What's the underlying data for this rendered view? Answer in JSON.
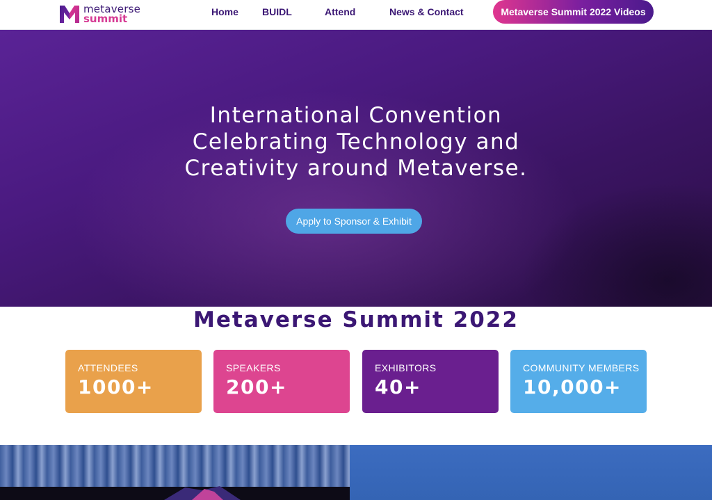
{
  "header": {
    "logo": {
      "line1": "metaverse",
      "line2": "summit",
      "icon": "metaverse-m-logo-icon"
    },
    "nav": [
      {
        "label": "Home"
      },
      {
        "label": "BUIDL"
      },
      {
        "label": "Attend"
      },
      {
        "label": "News & Contact"
      }
    ],
    "cta_label": "Metaverse Summit 2022 Videos"
  },
  "hero": {
    "title_lines": [
      "International Convention",
      "Celebrating Technology and",
      "Creativity around Metaverse."
    ],
    "button_label": "Apply to Sponsor & Exhibit"
  },
  "stats": {
    "title": "Metaverse Summit 2022",
    "cards": [
      {
        "label": "ATTENDEES",
        "value": "1000+",
        "color": "#e9a14b"
      },
      {
        "label": "SPEAKERS",
        "value": "200+",
        "color": "#dd4590"
      },
      {
        "label": "EXHIBITORS",
        "value": "40+",
        "color": "#6a1f8f"
      },
      {
        "label": "COMMUNITY MEMBERS",
        "value": "10,000+",
        "color": "#55ade9"
      }
    ]
  },
  "colors": {
    "brand_purple": "#3b1774",
    "brand_pink": "#d63b94",
    "accent_blue": "#4fa6e6"
  }
}
